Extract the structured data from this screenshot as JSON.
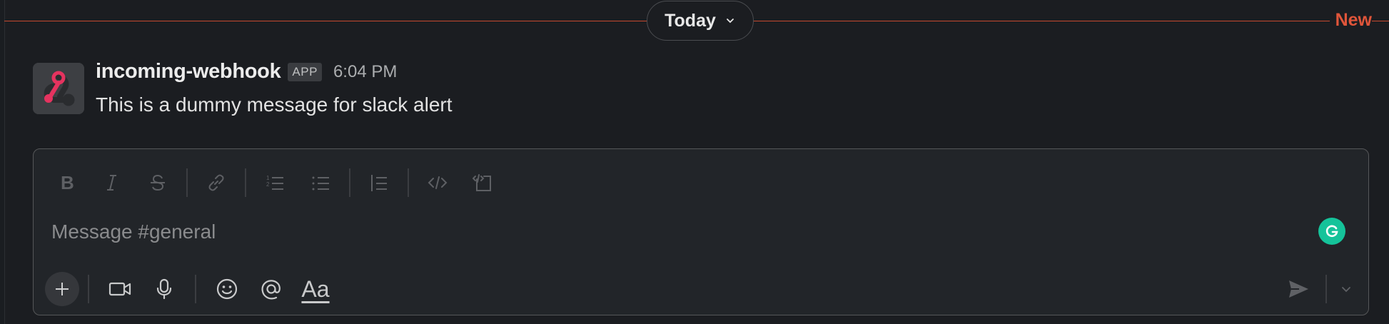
{
  "divider": {
    "label": "Today",
    "new_label": "New"
  },
  "message": {
    "sender": "incoming-webhook",
    "badge": "APP",
    "time": "6:04 PM",
    "text": "This is a dummy message for slack alert"
  },
  "composer": {
    "placeholder": "Message #general",
    "format_icons": [
      "bold-icon",
      "italic-icon",
      "strikethrough-icon",
      "link-icon",
      "ordered-list-icon",
      "bulleted-list-icon",
      "blockquote-icon",
      "code-icon",
      "code-block-icon"
    ],
    "aa_label": "Aa"
  },
  "colors": {
    "new_accent": "#e0553a",
    "divider_line": "#c5482f",
    "grammarly": "#15c39a",
    "avatar_pink": "#e5335f"
  }
}
